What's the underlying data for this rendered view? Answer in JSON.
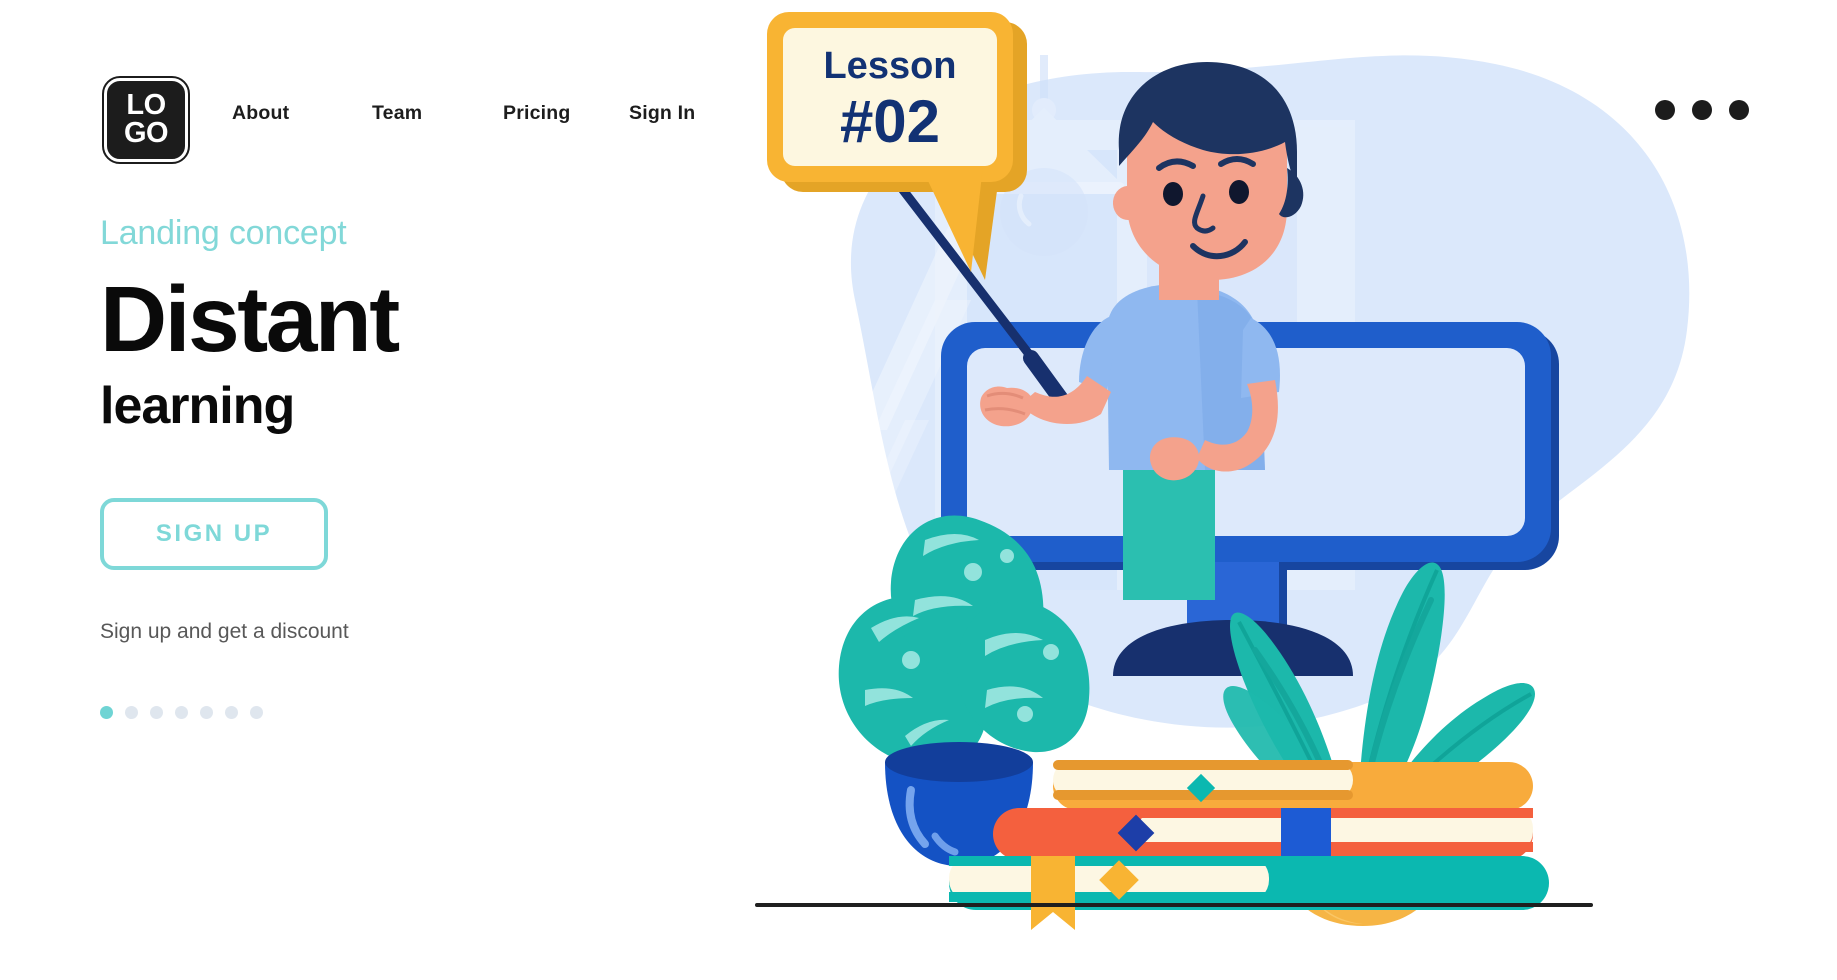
{
  "header": {
    "logo": {
      "line1": "LO",
      "line2": "GO",
      "name": "logo"
    },
    "nav": [
      {
        "label": "About"
      },
      {
        "label": "Team"
      },
      {
        "label": "Pricing"
      },
      {
        "label": "Sign In"
      }
    ],
    "menu_icon": "three-dots-icon"
  },
  "hero": {
    "eyebrow": "Landing concept",
    "title_main": "Distant",
    "title_sub": "learning",
    "cta_label": "SIGN UP",
    "discount_text": "Sign up and get a discount",
    "pager": {
      "total": 7,
      "active_index": 0
    }
  },
  "illustration": {
    "speech_bubble": {
      "line1": "Lesson",
      "line2": "#02"
    },
    "scene_items": [
      "teacher-character",
      "pointer-stick",
      "computer-monitor",
      "book-stack",
      "monstera-plant",
      "palm-plant",
      "background-blob"
    ]
  },
  "colors": {
    "accent_teal": "#7ed8d8",
    "pager_active": "#6fd4d4",
    "pager_inactive": "#dfe6ee",
    "text_dark": "#0a0a0a",
    "text_muted": "#585858",
    "bubble_border": "#f5b335",
    "bubble_fill": "#fdf7e0",
    "bubble_text": "#123274",
    "monitor_blue": "#1f56b8",
    "blob_blue": "#d9e7fb",
    "skin": "#f4a28c",
    "hair_navy": "#1d3461",
    "shirt_blue": "#8fb8f0",
    "pants_teal": "#2bbfb0",
    "book_amber": "#f8ab3c",
    "book_red": "#f4603e",
    "book_teal": "#0bb8b0",
    "page_cream": "#fdf7e3",
    "plant_green": "#18b4a8",
    "pot_blue": "#1452c4",
    "pot_amber": "#f6b545"
  }
}
